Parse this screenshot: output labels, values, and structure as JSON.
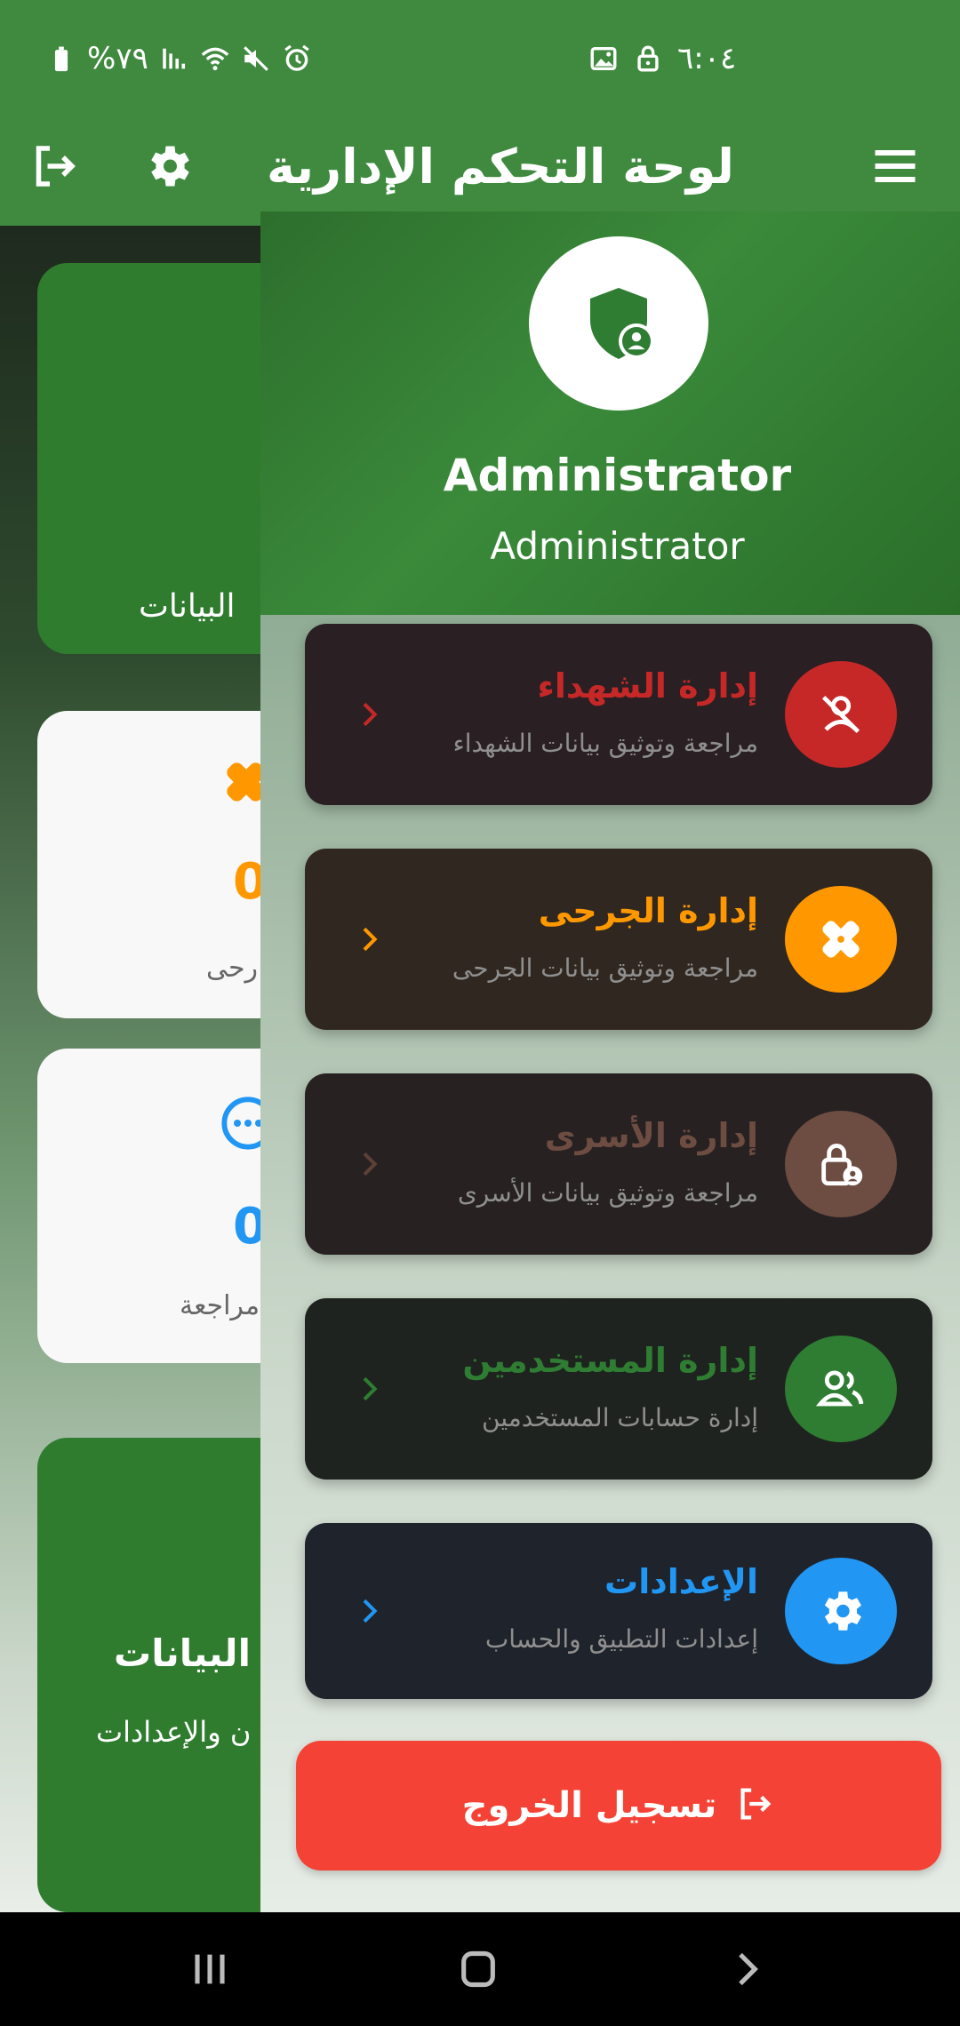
{
  "status_bar": {
    "battery": "%٧٩",
    "time": "٦:٠٤",
    "icons": [
      "battery-icon",
      "signal-icon",
      "wifi-icon",
      "mute-icon",
      "alarm-icon",
      "image-notification-icon",
      "lock-notification-icon"
    ]
  },
  "app_bar": {
    "title": "لوحة التحكم الإدارية",
    "icons": [
      "logout-icon",
      "settings-icon",
      "menu-icon"
    ]
  },
  "background": {
    "card1_text": "البيانات",
    "card2_value": "0",
    "card2_label": "رحى",
    "card3_value": "0",
    "card3_label": "مراجعة",
    "card4_title": "البيانات",
    "card4_sub": "ن والإعدادات"
  },
  "drawer": {
    "user_name": "Administrator",
    "user_role": "Administrator",
    "items": [
      {
        "title": "إدارة الشهداء",
        "subtitle": "مراجعة وتوثيق بيانات الشهداء",
        "icon": "no-person-icon",
        "color": "#c62828",
        "bg": "#2a2023"
      },
      {
        "title": "إدارة الجرحى",
        "subtitle": "مراجعة وتوثيق بيانات الجرحى",
        "icon": "bandage-icon",
        "color": "#ff9800",
        "bg": "#302820"
      },
      {
        "title": "إدارة الأسرى",
        "subtitle": "مراجعة وتوثيق بيانات الأسرى",
        "icon": "locked-person-icon",
        "color": "#6d4c41",
        "bg": "#272122"
      },
      {
        "title": "إدارة المستخدمين",
        "subtitle": "إدارة حسابات المستخدمين",
        "icon": "people-icon",
        "color": "#2e7d32",
        "bg": "#1f231f"
      },
      {
        "title": "الإعدادات",
        "subtitle": "إعدادات التطبيق والحساب",
        "icon": "gear-icon",
        "color": "#2196f3",
        "bg": "#1f232b"
      }
    ],
    "logout_label": "تسجيل الخروج"
  },
  "nav_bar": {
    "icons": [
      "recents-icon",
      "home-icon",
      "back-icon"
    ]
  }
}
